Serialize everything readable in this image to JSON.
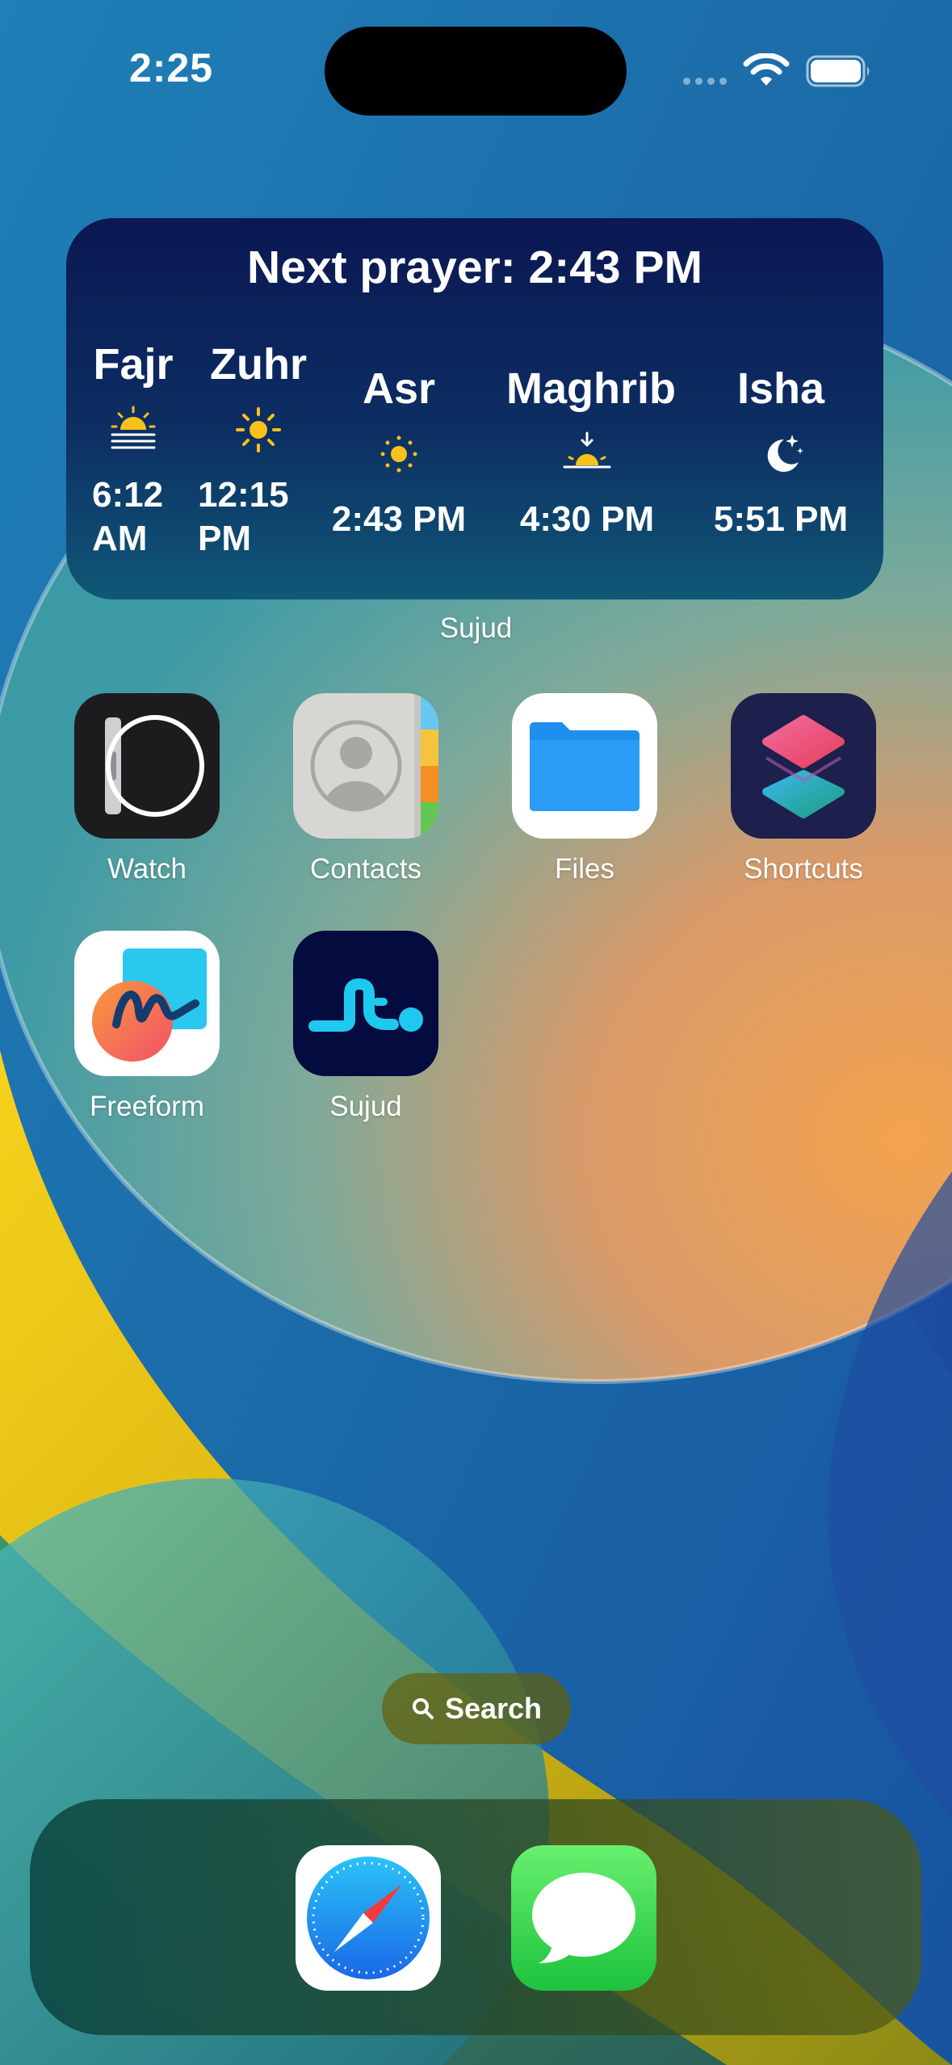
{
  "status_bar": {
    "time": "2:25"
  },
  "widget": {
    "header": "Next prayer:  2:43 PM",
    "app_name": "Sujud",
    "prayers": [
      {
        "name": "Fajr",
        "icon": "sunrise-icon",
        "time": "6:12\nAM"
      },
      {
        "name": "Zuhr",
        "icon": "sun-icon",
        "time": "12:15\nPM"
      },
      {
        "name": "Asr",
        "icon": "sun-small-icon",
        "time": "2:43 PM"
      },
      {
        "name": "Maghrib",
        "icon": "sunset-icon",
        "time": "4:30 PM"
      },
      {
        "name": "Isha",
        "icon": "moon-stars-icon",
        "time": "5:51 PM"
      }
    ]
  },
  "apps": [
    {
      "label": "Watch",
      "icon": "watch-app-icon"
    },
    {
      "label": "Contacts",
      "icon": "contacts-app-icon"
    },
    {
      "label": "Files",
      "icon": "files-app-icon"
    },
    {
      "label": "Shortcuts",
      "icon": "shortcuts-app-icon"
    },
    {
      "label": "Freeform",
      "icon": "freeform-app-icon"
    },
    {
      "label": "Sujud",
      "icon": "sujud-app-icon"
    }
  ],
  "search": {
    "label": "Search",
    "icon": "search-icon"
  },
  "dock": [
    {
      "label": "Safari",
      "icon": "safari-icon"
    },
    {
      "label": "Messages",
      "icon": "messages-icon"
    }
  ],
  "colors": {
    "widget_bg_top": "#0b1752",
    "widget_bg_bottom": "#105876",
    "sun_yellow": "#f7c21a",
    "sujud_cyan": "#1fc8ef"
  }
}
